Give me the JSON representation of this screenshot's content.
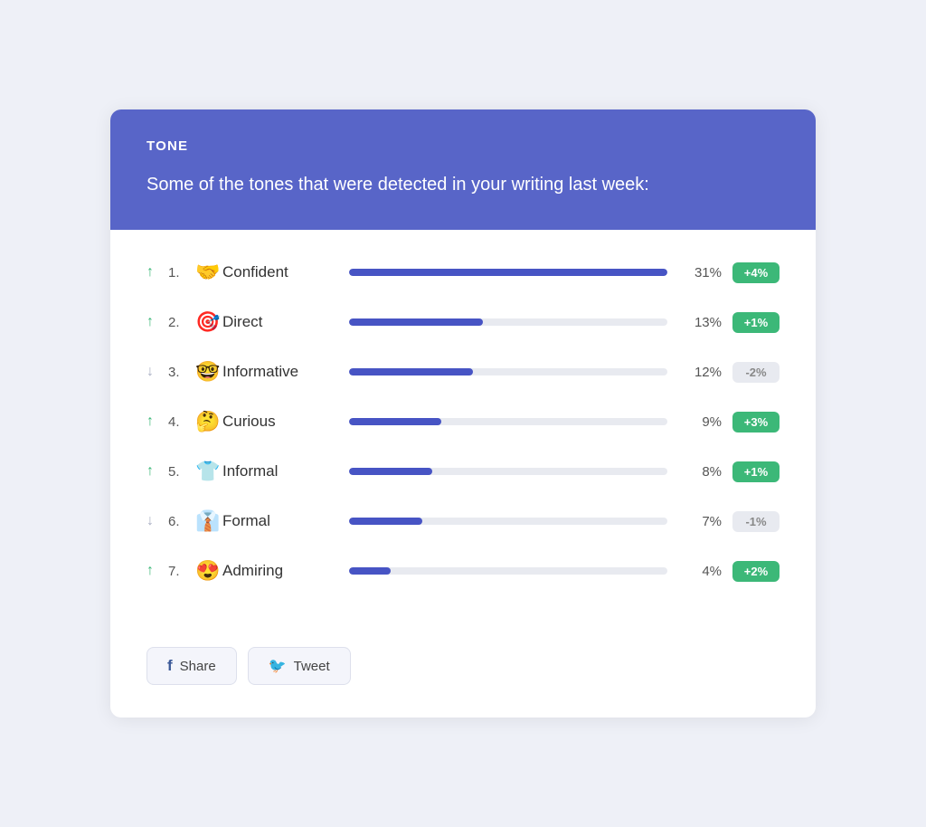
{
  "header": {
    "title": "TONE",
    "subtitle": "Some of the tones that were detected in your writing last week:"
  },
  "tones": [
    {
      "rank": "1.",
      "emoji": "🤝",
      "name": "Confident",
      "percent": 31,
      "percentLabel": "31%",
      "badge": "+4%",
      "badgeType": "positive",
      "arrow": "up"
    },
    {
      "rank": "2.",
      "emoji": "🎯",
      "name": "Direct",
      "percent": 13,
      "percentLabel": "13%",
      "badge": "+1%",
      "badgeType": "positive",
      "arrow": "up"
    },
    {
      "rank": "3.",
      "emoji": "🤓",
      "name": "Informative",
      "percent": 12,
      "percentLabel": "12%",
      "badge": "-2%",
      "badgeType": "negative",
      "arrow": "down"
    },
    {
      "rank": "4.",
      "emoji": "🤔",
      "name": "Curious",
      "percent": 9,
      "percentLabel": "9%",
      "badge": "+3%",
      "badgeType": "positive",
      "arrow": "up"
    },
    {
      "rank": "5.",
      "emoji": "👕",
      "name": "Informal",
      "percent": 8,
      "percentLabel": "8%",
      "badge": "+1%",
      "badgeType": "positive",
      "arrow": "up"
    },
    {
      "rank": "6.",
      "emoji": "👔",
      "name": "Formal",
      "percent": 7,
      "percentLabel": "7%",
      "badge": "-1%",
      "badgeType": "negative",
      "arrow": "down"
    },
    {
      "rank": "7.",
      "emoji": "😍",
      "name": "Admiring",
      "percent": 4,
      "percentLabel": "4%",
      "badge": "+2%",
      "badgeType": "positive",
      "arrow": "up"
    }
  ],
  "maxPercent": 31,
  "footer": {
    "shareLabel": "Share",
    "tweetLabel": "Tweet"
  }
}
